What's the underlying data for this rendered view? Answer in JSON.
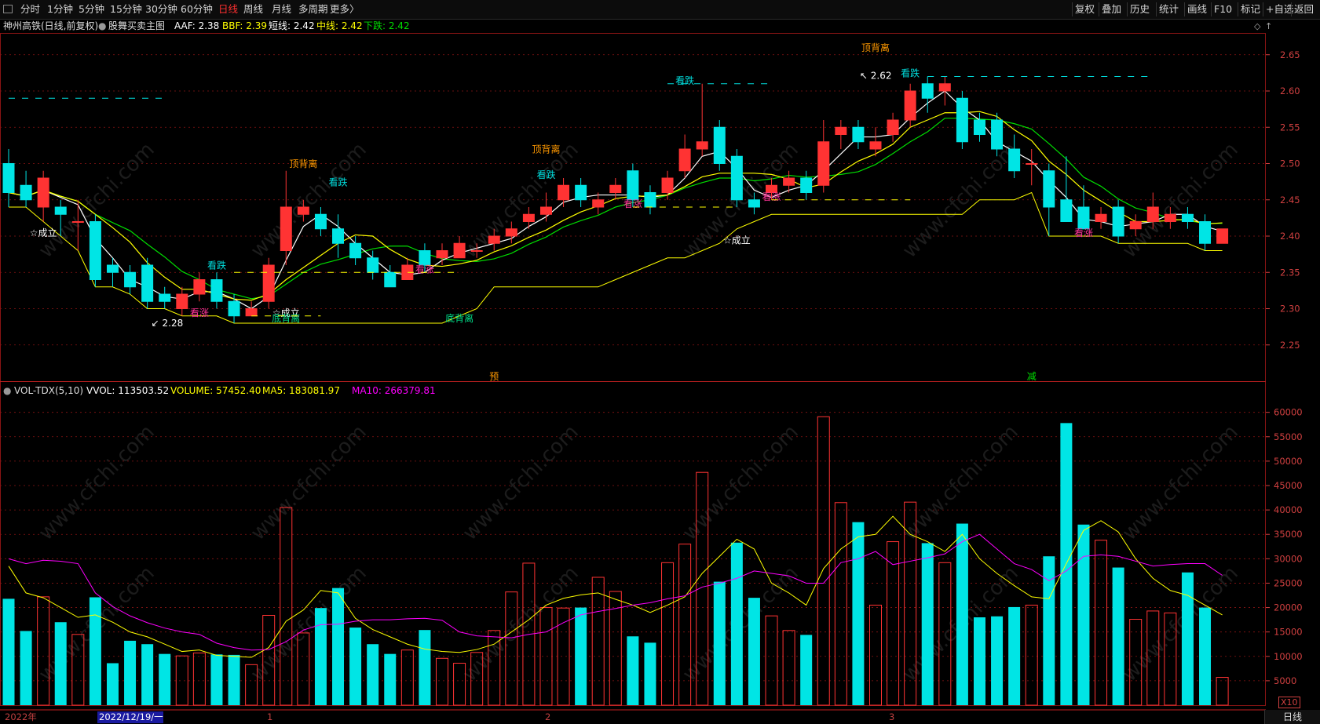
{
  "toolbar": {
    "left_items": [
      "分时",
      "1分钟",
      "5分钟",
      "15分钟",
      "30分钟",
      "60分钟",
      "日线",
      "周线",
      "月线",
      "多周期",
      "更多〉"
    ],
    "active": "日线",
    "right_items": [
      "复权",
      "叠加",
      "历史",
      "统计",
      "画线",
      "F10",
      "标记",
      "+自选",
      "返回"
    ]
  },
  "main_info": {
    "stock": "神州高铁(日线,前复权)",
    "indicator": "股舞买卖主图",
    "aaf": "AAF: 2.38",
    "bbf": "BBF: 2.39",
    "short": "短线: 2.42",
    "mid": "中线: 2.42",
    "down": "下跌: 2.42"
  },
  "vol_info": {
    "name": "VOL-TDX(5,10)",
    "vvol": "VVOL: 113503.52",
    "volume": "VOLUME: 57452.40",
    "ma5": "MA5: 183081.97",
    "ma10": "MA10: 266379.81"
  },
  "colors": {
    "up": "#ff3333",
    "down": "#00e5e5",
    "short": "#ffffff",
    "mid": "#ffff00",
    "down_line": "#00dd00",
    "ma10": "#ff00ff",
    "grid": "#8a1414",
    "axis": "#d04040"
  },
  "price_axis": [
    "2.65",
    "2.60",
    "2.55",
    "2.50",
    "2.45",
    "2.40",
    "2.35",
    "2.30",
    "2.25"
  ],
  "volume_axis": [
    "60000",
    "55000",
    "50000",
    "45000",
    "40000",
    "35000",
    "30000",
    "25000",
    "20000",
    "15000",
    "10000",
    "5000"
  ],
  "x_labels": [
    "2022年",
    "2022/12/19/一",
    "1",
    "2",
    "3"
  ],
  "markers": {
    "high": "2.62",
    "low": "2.28",
    "yu": "预",
    "jian": "减"
  },
  "labels": {
    "top_div": "顶背离",
    "bottom_div": "底背离",
    "kan_die": "看跌",
    "kan_zhang": "看涨",
    "cheng_li": "☆成立"
  },
  "period_button": "日线",
  "x10": "X10",
  "watermark": "www.cfchi.com",
  "chart_data": {
    "type": "candlestick",
    "price_range": [
      2.2,
      2.68
    ],
    "volume_range": [
      0,
      63000
    ],
    "candles": [
      [
        2.5,
        2.46,
        2.52,
        2.44,
        21800
      ],
      [
        2.47,
        2.45,
        2.49,
        2.44,
        15200
      ],
      [
        2.44,
        2.48,
        2.49,
        2.42,
        22200
      ],
      [
        2.44,
        2.43,
        2.45,
        2.4,
        17000
      ],
      [
        2.42,
        2.42,
        2.45,
        2.38,
        14500
      ],
      [
        2.42,
        2.34,
        2.43,
        2.33,
        22100
      ],
      [
        2.36,
        2.35,
        2.37,
        2.33,
        8600
      ],
      [
        2.35,
        2.33,
        2.36,
        2.32,
        13200
      ],
      [
        2.36,
        2.31,
        2.37,
        2.3,
        12500
      ],
      [
        2.32,
        2.31,
        2.33,
        2.3,
        10500
      ],
      [
        2.3,
        2.32,
        2.33,
        2.29,
        10100
      ],
      [
        2.32,
        2.34,
        2.35,
        2.31,
        10700
      ],
      [
        2.34,
        2.31,
        2.35,
        2.3,
        10400
      ],
      [
        2.31,
        2.29,
        2.32,
        2.28,
        10300
      ],
      [
        2.29,
        2.3,
        2.31,
        2.29,
        8300
      ],
      [
        2.31,
        2.36,
        2.37,
        2.3,
        18400
      ],
      [
        2.38,
        2.44,
        2.49,
        2.36,
        40500
      ],
      [
        2.43,
        2.44,
        2.45,
        2.42,
        14800
      ],
      [
        2.43,
        2.41,
        2.44,
        2.4,
        19900
      ],
      [
        2.41,
        2.39,
        2.43,
        2.37,
        24000
      ],
      [
        2.39,
        2.37,
        2.4,
        2.36,
        15900
      ],
      [
        2.37,
        2.35,
        2.38,
        2.34,
        12500
      ],
      [
        2.35,
        2.33,
        2.36,
        2.33,
        10500
      ],
      [
        2.34,
        2.36,
        2.37,
        2.34,
        11300
      ],
      [
        2.38,
        2.36,
        2.39,
        2.35,
        15400
      ],
      [
        2.37,
        2.38,
        2.39,
        2.36,
        9600
      ],
      [
        2.37,
        2.39,
        2.4,
        2.37,
        8600
      ],
      [
        2.38,
        2.38,
        2.39,
        2.37,
        10800
      ],
      [
        2.39,
        2.4,
        2.41,
        2.38,
        15300
      ],
      [
        2.4,
        2.41,
        2.42,
        2.39,
        23200
      ],
      [
        2.42,
        2.43,
        2.44,
        2.41,
        29100
      ],
      [
        2.43,
        2.44,
        2.46,
        2.42,
        20000
      ],
      [
        2.45,
        2.47,
        2.48,
        2.44,
        19900
      ],
      [
        2.47,
        2.45,
        2.48,
        2.44,
        20000
      ],
      [
        2.44,
        2.45,
        2.46,
        2.43,
        26200
      ],
      [
        2.46,
        2.47,
        2.48,
        2.45,
        23300
      ],
      [
        2.49,
        2.45,
        2.5,
        2.44,
        14100
      ],
      [
        2.46,
        2.44,
        2.47,
        2.43,
        12800
      ],
      [
        2.46,
        2.48,
        2.49,
        2.45,
        29200
      ],
      [
        2.49,
        2.52,
        2.54,
        2.48,
        33000
      ],
      [
        2.52,
        2.53,
        2.61,
        2.51,
        47700
      ],
      [
        2.55,
        2.5,
        2.56,
        2.49,
        25300
      ],
      [
        2.51,
        2.45,
        2.52,
        2.44,
        33300
      ],
      [
        2.45,
        2.44,
        2.46,
        2.43,
        22000
      ],
      [
        2.46,
        2.47,
        2.48,
        2.45,
        18300
      ],
      [
        2.47,
        2.48,
        2.49,
        2.46,
        15300
      ],
      [
        2.48,
        2.46,
        2.49,
        2.45,
        14400
      ],
      [
        2.47,
        2.53,
        2.56,
        2.46,
        59100
      ],
      [
        2.54,
        2.55,
        2.56,
        2.52,
        41500
      ],
      [
        2.55,
        2.53,
        2.56,
        2.52,
        37500
      ],
      [
        2.52,
        2.53,
        2.55,
        2.51,
        20500
      ],
      [
        2.54,
        2.56,
        2.57,
        2.53,
        33500
      ],
      [
        2.56,
        2.6,
        2.61,
        2.55,
        41600
      ],
      [
        2.61,
        2.59,
        2.62,
        2.57,
        33200
      ],
      [
        2.6,
        2.61,
        2.62,
        2.58,
        29200
      ],
      [
        2.59,
        2.53,
        2.6,
        2.52,
        37200
      ],
      [
        2.56,
        2.54,
        2.57,
        2.53,
        18000
      ],
      [
        2.56,
        2.52,
        2.57,
        2.51,
        18200
      ],
      [
        2.52,
        2.49,
        2.54,
        2.48,
        20100
      ],
      [
        2.5,
        2.5,
        2.52,
        2.47,
        20500
      ],
      [
        2.49,
        2.44,
        2.5,
        2.4,
        30500
      ],
      [
        2.45,
        2.42,
        2.51,
        2.42,
        57800
      ],
      [
        2.44,
        2.41,
        2.47,
        2.41,
        37000
      ],
      [
        2.42,
        2.43,
        2.44,
        2.41,
        33800
      ],
      [
        2.44,
        2.4,
        2.45,
        2.39,
        28200
      ],
      [
        2.41,
        2.42,
        2.43,
        2.4,
        17600
      ],
      [
        2.42,
        2.44,
        2.46,
        2.41,
        19300
      ],
      [
        2.42,
        2.43,
        2.44,
        2.41,
        18900
      ],
      [
        2.43,
        2.42,
        2.44,
        2.41,
        27200
      ],
      [
        2.42,
        2.39,
        2.43,
        2.38,
        20000
      ],
      [
        2.39,
        2.41,
        2.41,
        2.39,
        5700
      ]
    ],
    "ma5_volume": [
      28500,
      23000,
      22000,
      20000,
      18000,
      18500,
      17000,
      15000,
      14000,
      12500,
      11000,
      11300,
      10200,
      10000,
      9800,
      11800,
      17200,
      19500,
      23500,
      23000,
      17800,
      15500,
      14000,
      12500,
      11500,
      11000,
      10800,
      11400,
      12500,
      15000,
      17500,
      20500,
      21900,
      22600,
      23000,
      21700,
      20500,
      19000,
      20500,
      22200,
      27000,
      30500,
      34000,
      32000,
      25000,
      23000,
      20500,
      28000,
      32000,
      34500,
      35000,
      38700,
      35000,
      33500,
      31500,
      35000,
      30000,
      27000,
      24500,
      22200,
      21800,
      29000,
      35800,
      37800,
      35500,
      30000,
      26000,
      23500,
      22500,
      20500,
      18500
    ],
    "ma10_volume": [
      30000,
      29000,
      29700,
      29500,
      29000,
      23000,
      20200,
      18300,
      16900,
      15800,
      15000,
      14500,
      12700,
      11800,
      11300,
      11400,
      13000,
      15400,
      16500,
      16600,
      17200,
      17500,
      17500,
      17700,
      17800,
      17400,
      15000,
      14200,
      14000,
      13800,
      14500,
      15000,
      16900,
      18500,
      19200,
      19800,
      20500,
      21000,
      21800,
      22400,
      24200,
      25000,
      26000,
      27500,
      27000,
      26500,
      25000,
      25000,
      29200,
      30000,
      31500,
      28800,
      29500,
      30200,
      31000,
      33500,
      35000,
      32000,
      29000,
      27800,
      25500,
      27500,
      30500,
      30800,
      30500,
      29500,
      28500,
      28800,
      29000,
      29000,
      26600
    ]
  }
}
